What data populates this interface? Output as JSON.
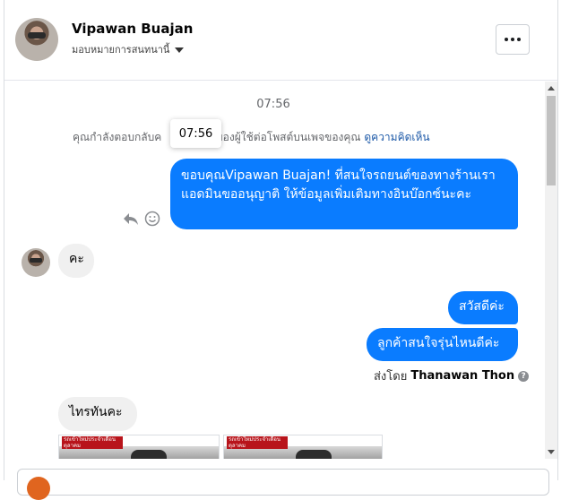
{
  "header": {
    "contact_name": "Vipawan Buajan",
    "assign_label": "มอบหมายการสนทนานี้",
    "more_icon": "more-horizontal-icon"
  },
  "thread": {
    "timestamp": "07:56",
    "notice_text": "คุณกำลังตอบกลับค",
    "notice_text_tail": "นของผู้ใช้ต่อโพสต์บนเพจของคุณ",
    "notice_link": "ดูความคิดเห็น",
    "tooltip_time": "07:56",
    "messages": [
      {
        "direction": "out",
        "text": "ขอบคุณVipawan Buajan! ที่สนใจรถยนต์ของทางร้านเรา แอดมินขออนุญาติ ให้ข้อมูลเพิ่มเติมทางอินบ๊อกซ์นะคะ"
      },
      {
        "direction": "in",
        "text": "คะ"
      },
      {
        "direction": "out",
        "text": "สวัสดีค่ะ"
      },
      {
        "direction": "out",
        "text": "ลูกค้าสนใจรุ่นไหนดีค่ะ"
      },
      {
        "direction": "in",
        "text": "ไทรทันคะ"
      }
    ],
    "sent_by_prefix": "ส่งโดย",
    "sent_by_name": "Thanawan Thon",
    "cards": [
      {
        "banner": "รถเข้าใหม่ประจำเดือน ตุลาคม"
      },
      {
        "banner": "รถเข้าใหม่ประจำเดือน ตุลาคม"
      }
    ]
  },
  "colors": {
    "outgoing_bubble": "#0a7cff",
    "incoming_bubble": "#f0f0f0",
    "link": "#1e5aa8"
  }
}
